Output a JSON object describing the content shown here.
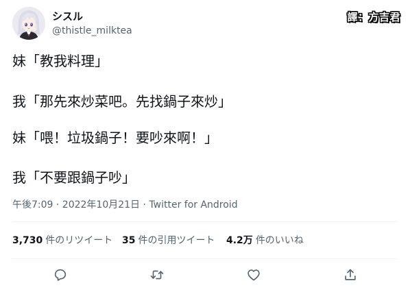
{
  "author": {
    "display_name": "シスル",
    "handle": "@thistle_milktea",
    "avatar_icon": "anime-girl-avatar"
  },
  "translator_tag": "譯：方吉君",
  "tweet": {
    "lines": [
      "妹「教我料理」",
      "我「那先來炒菜吧。先找鍋子來炒」",
      "妹「喂！垃圾鍋子！要吵來啊！」",
      "我「不要跟鍋子吵」"
    ],
    "timestamp": "午後7:09 · 2022年10月21日 · Twitter for Android"
  },
  "stats": {
    "retweets": {
      "count": "3,730",
      "label": "件のリツイート"
    },
    "quotes": {
      "count": "35",
      "label": "件の引用ツイート"
    },
    "likes": {
      "count": "4.2万",
      "label": "件のいいね"
    }
  },
  "actions": {
    "reply": "reply-icon",
    "retweet": "retweet-icon",
    "like": "heart-icon",
    "share": "share-icon"
  },
  "colors": {
    "text": "#0f1419",
    "secondary_text": "#536471",
    "divider": "#eff3f4"
  }
}
